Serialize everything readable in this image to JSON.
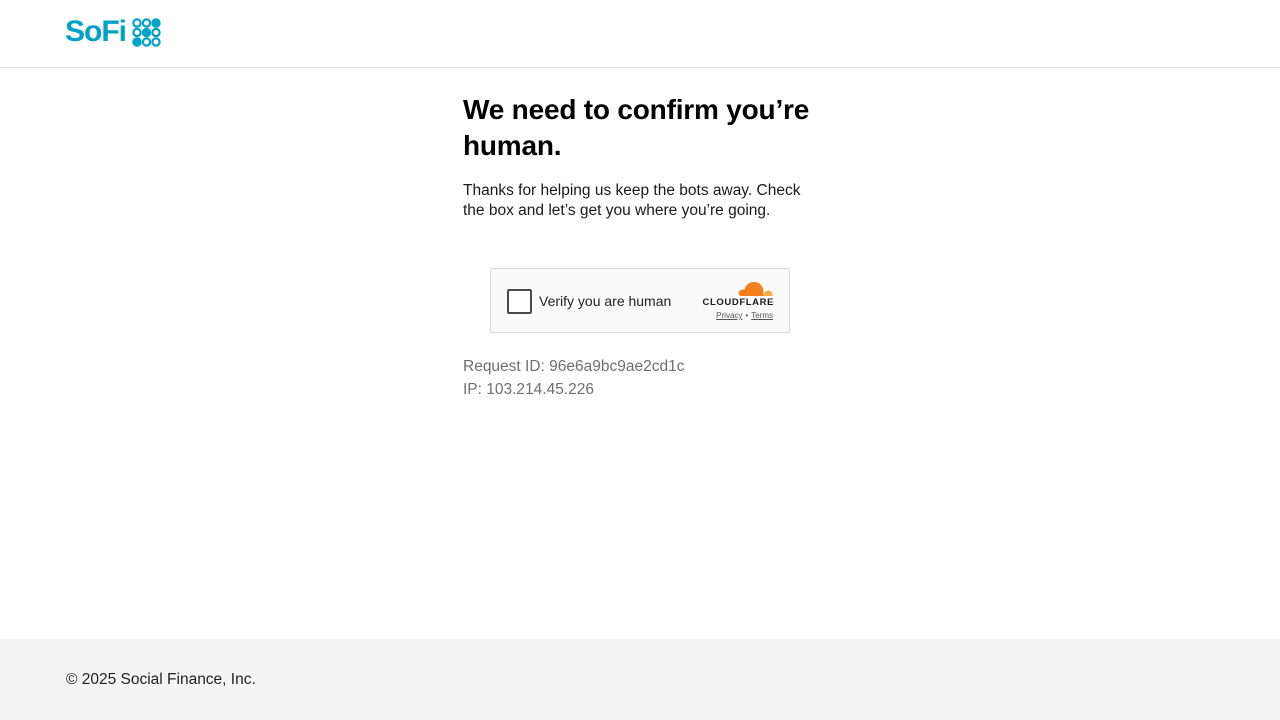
{
  "header": {
    "logo_text": "SoFi",
    "logo_icon": "sofi-dots-logo-icon",
    "brand_color": "#00a2c7"
  },
  "main": {
    "title": "We need to confirm you’re human.",
    "subtitle": "Thanks for helping us keep the bots away. Check the box and let’s get you where you’re going."
  },
  "captcha": {
    "checkbox_label": "Verify you are human",
    "checked": false,
    "provider": "CLOUDFLARE",
    "provider_icon": "cloudflare-cloud-icon",
    "privacy_link": "Privacy",
    "separator": "•",
    "terms_link": "Terms",
    "accent_color": "#f38020"
  },
  "meta": {
    "request_id": "Request ID: 96e6a9bc9ae2cd1c",
    "ip": "IP: 103.214.45.226"
  },
  "footer": {
    "copyright": "© 2025 Social Finance, Inc."
  }
}
